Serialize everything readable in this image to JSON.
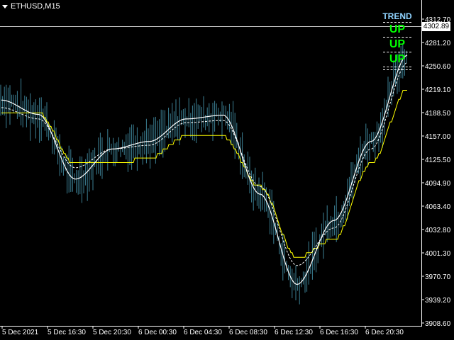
{
  "window": {
    "title": "ETHUSD,M15"
  },
  "price_axis": {
    "labels": [
      "4312.70",
      "4281.20",
      "4250.60",
      "4219.10",
      "4188.50",
      "4157.00",
      "4125.50",
      "4094.90",
      "4063.40",
      "4032.80",
      "4001.30",
      "3970.70",
      "3939.20",
      "3908.60"
    ],
    "current": "4302.89"
  },
  "time_axis": {
    "labels": [
      "5 Dec 2021",
      "5 Dec 16:30",
      "5 Dec 20:30",
      "6 Dec 00:30",
      "6 Dec 04:30",
      "6 Dec 08:30",
      "6 Dec 12:30",
      "6 Dec 16:30",
      "6 Dec 20:30"
    ]
  },
  "trend_panel": {
    "heading": "TREND",
    "rows": [
      "UP",
      "UP",
      "UP"
    ]
  },
  "colors": {
    "background": "#000000",
    "candles": "#3b7f93",
    "smooth_line": "#ffffff",
    "signal_line": "#ffffff",
    "stop_line": "#ffff00",
    "trend_heading": "#8fd3ff",
    "trend_up": "#00ff00"
  },
  "chart_data": {
    "type": "line",
    "symbol": "ETHUSD",
    "timeframe": "M15",
    "ylim": [
      3908.6,
      4312.7
    ],
    "x": [
      "5 Dec 2021",
      "5 Dec 16:30",
      "5 Dec 20:30",
      "6 Dec 00:30",
      "6 Dec 04:30",
      "6 Dec 08:30",
      "6 Dec 12:30",
      "6 Dec 16:30",
      "6 Dec 20:30"
    ],
    "series": [
      {
        "values": [
          4205,
          4186,
          4100,
          4140,
          4150,
          4180,
          4185,
          4080,
          3960,
          4045,
          4150,
          4265
        ]
      },
      {
        "values": [
          4195,
          4180,
          4115,
          4140,
          4145,
          4175,
          4178,
          4090,
          3985,
          4035,
          4140,
          4255
        ]
      },
      {
        "values": [
          4188,
          4188,
          4120,
          4120,
          4128,
          4157,
          4157,
          4090,
          3995,
          4020,
          4120,
          4220
        ]
      }
    ]
  }
}
